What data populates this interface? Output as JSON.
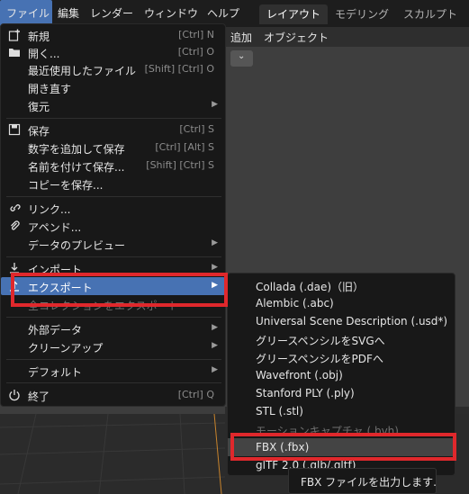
{
  "topbar": {
    "menus": [
      "ファイル",
      "編集",
      "レンダー",
      "ウィンドウ",
      "ヘルプ"
    ],
    "workspaces": [
      "レイアウト",
      "モデリング",
      "スカルプト"
    ]
  },
  "viewport": {
    "header_items": [
      "追加",
      "オブジェクト"
    ]
  },
  "file_menu": {
    "new": {
      "label": "新規",
      "shortcut": "[Ctrl] N"
    },
    "open": {
      "label": "開く...",
      "shortcut": "[Ctrl] O"
    },
    "open_recent": {
      "label": "最近使用したファイル",
      "shortcut": "[Shift] [Ctrl] O"
    },
    "revert": {
      "label": "開き直す"
    },
    "recover": {
      "label": "復元"
    },
    "save": {
      "label": "保存",
      "shortcut": "[Ctrl] S"
    },
    "save_incremental": {
      "label": "数字を追加して保存",
      "shortcut": "[Ctrl] [Alt] S"
    },
    "save_as": {
      "label": "名前を付けて保存...",
      "shortcut": "[Shift] [Ctrl] S"
    },
    "save_copy": {
      "label": "コピーを保存..."
    },
    "link": {
      "label": "リンク..."
    },
    "append": {
      "label": "アペンド..."
    },
    "data_previews": {
      "label": "データのプレビュー"
    },
    "import": {
      "label": "インポート"
    },
    "export": {
      "label": "エクスポート"
    },
    "export_all_collections": {
      "label": "全コレクションをエクスポート"
    },
    "external_data": {
      "label": "外部データ"
    },
    "clean_up": {
      "label": "クリーンアップ"
    },
    "defaults": {
      "label": "デフォルト"
    },
    "quit": {
      "label": "終了",
      "shortcut": "[Ctrl] Q"
    }
  },
  "export_menu": {
    "items": [
      "Collada (.dae)（旧）",
      "Alembic (.abc)",
      "Universal Scene Description (.usd*)",
      "グリースペンシルをSVGへ",
      "グリースペンシルをPDFへ",
      "Wavefront (.obj)",
      "Stanford PLY (.ply)",
      "STL (.stl)",
      "モーションキャプチャ (.bvh)",
      "FBX (.fbx)",
      "glTF 2.0 (.glb/.gltf)"
    ]
  },
  "tooltip": {
    "text": "FBX ファイルを出力します."
  },
  "colors": {
    "accent": "#4772b3",
    "annotation": "#e0282c",
    "menu_bg": "#181818"
  }
}
